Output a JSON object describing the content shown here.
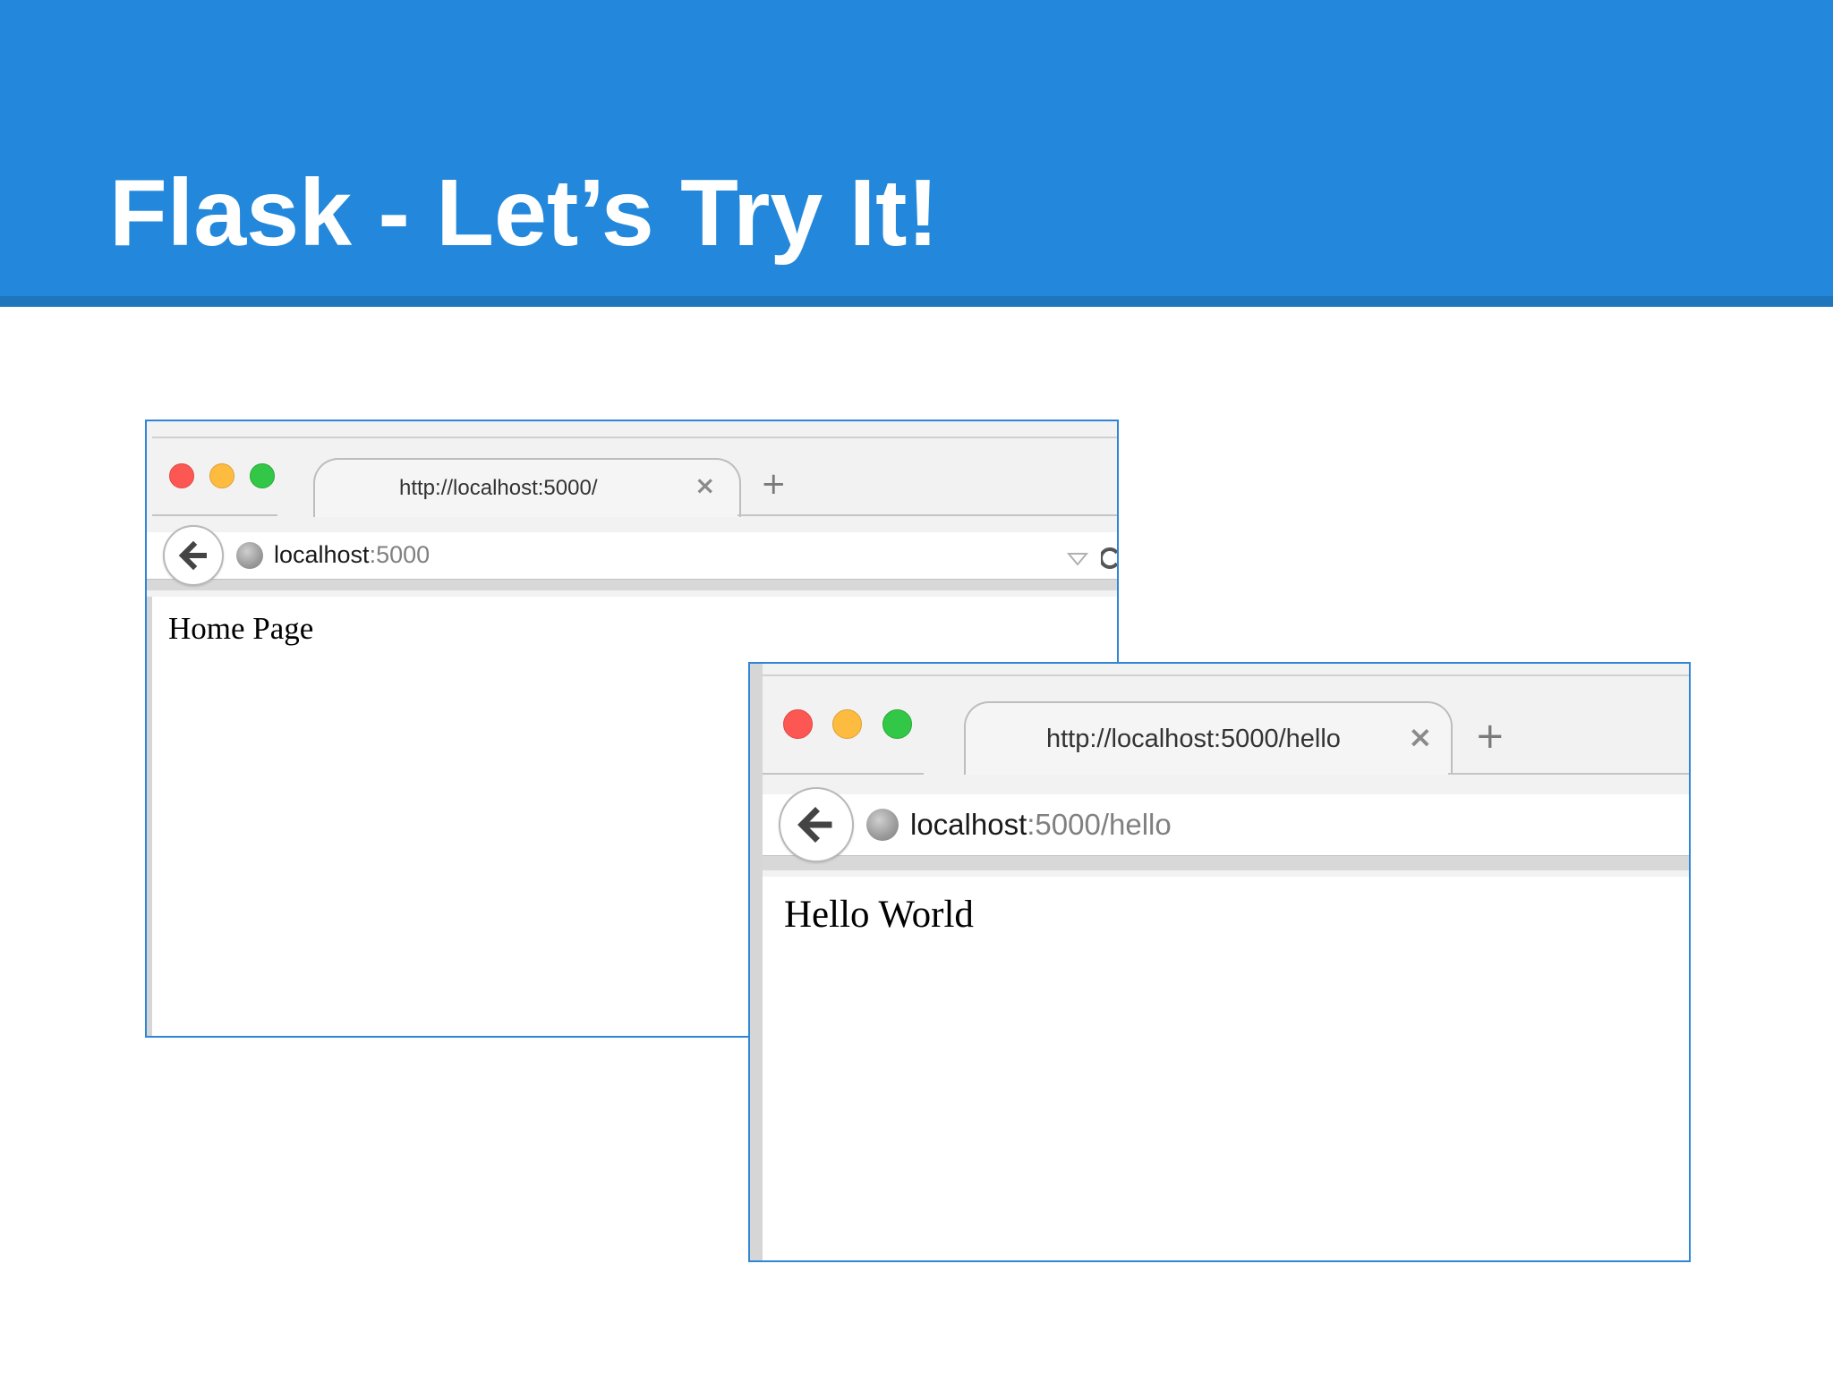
{
  "slide": {
    "title": "Flask - Let’s Try It!"
  },
  "browser_home": {
    "tab_title": "http://localhost:5000/",
    "tab_close": "×",
    "new_tab": "+",
    "url_host": "localhost",
    "url_rest": ":5000",
    "page_content": "Home Page"
  },
  "browser_hello": {
    "tab_title": "http://localhost:5000/hello",
    "tab_close": "×",
    "new_tab": "+",
    "url_host": "localhost",
    "url_rest": ":5000/hello",
    "page_content": "Hello World"
  },
  "colors": {
    "header_blue": "#2388db",
    "frame_blue": "#2f86d6",
    "traffic_red": "#fc5753",
    "traffic_yellow": "#fdbc40",
    "traffic_green": "#33c748"
  },
  "icons": [
    "back-arrow-icon",
    "globe-icon",
    "dropdown-icon",
    "reload-icon",
    "close-icon",
    "plus-icon"
  ]
}
